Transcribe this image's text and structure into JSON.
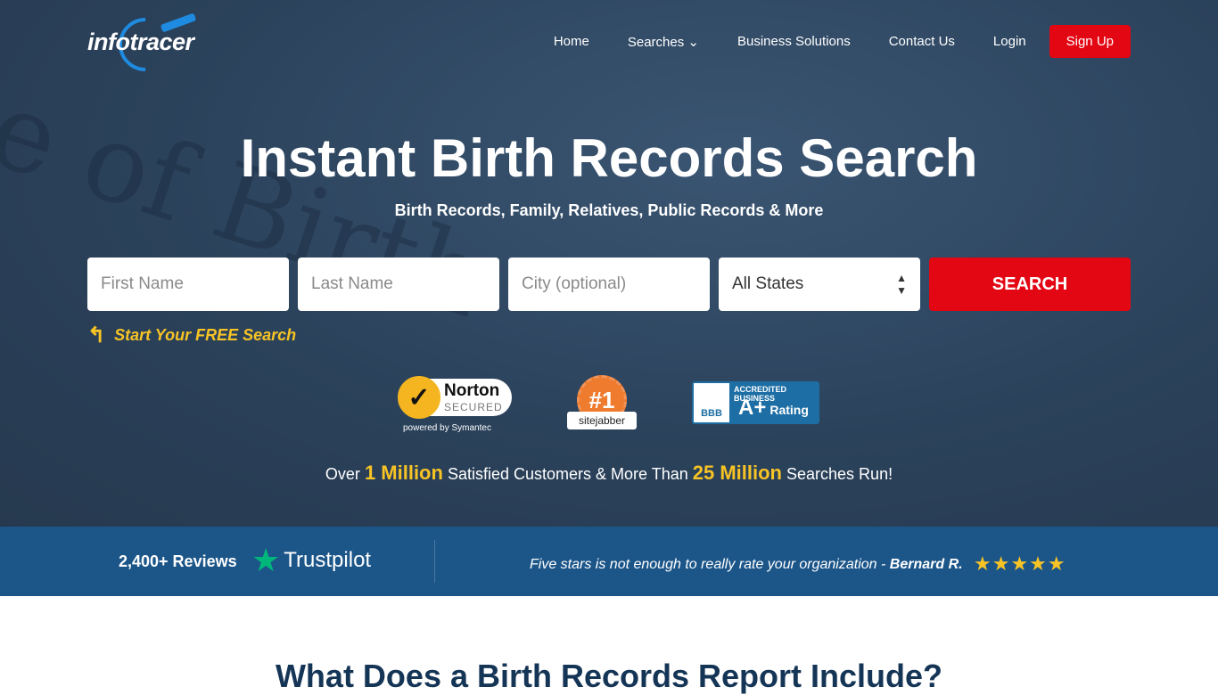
{
  "brand": {
    "logo_text": "infotracer",
    "colors": {
      "accent": "#e30613",
      "band": "#1c5689",
      "highlight": "#f7c325"
    }
  },
  "nav": {
    "items": [
      "Home",
      "Searches",
      "Business Solutions",
      "Contact Us",
      "Login"
    ],
    "signup": "Sign Up"
  },
  "hero": {
    "title": "Instant Birth Records Search",
    "subtitle": "Birth Records, Family, Relatives, Public Records & More"
  },
  "form": {
    "first_placeholder": "First Name",
    "last_placeholder": "Last Name",
    "city_placeholder": "City (optional)",
    "state_value": "All States",
    "search_label": "SEARCH",
    "free_label": "Start Your FREE Search"
  },
  "badges": {
    "norton_name": "Norton",
    "norton_secured": "SECURED",
    "norton_powered": "powered by Symantec",
    "sitejabber_rank": "#1",
    "sitejabber_name": "sitejabber",
    "bbb_label": "BBB",
    "bbb_accredited": "ACCREDITED BUSINESS",
    "bbb_grade": "A+",
    "bbb_rating": "Rating"
  },
  "stats": {
    "pre": "Over",
    "customers": "1 Million",
    "mid": "Satisfied Customers & More Than",
    "searches": "25 Million",
    "post": "Searches Run!"
  },
  "reviews": {
    "count": "2,400+ Reviews",
    "provider": "Trustpilot",
    "quote": "Five stars is not enough to really rate your organization -",
    "author": "Bernard R.",
    "stars": 5
  },
  "section": {
    "heading": "What Does a Birth Records Report Include?"
  }
}
